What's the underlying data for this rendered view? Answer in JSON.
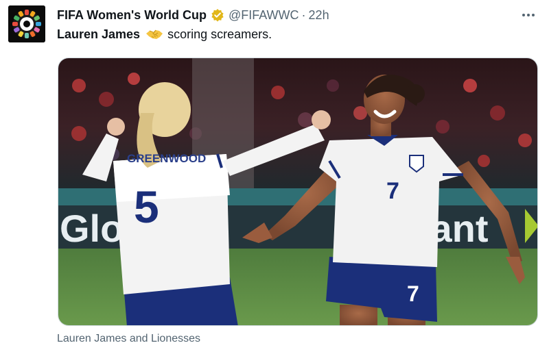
{
  "tweet": {
    "author": {
      "display_name": "FIFA Women's World Cup",
      "handle": "@FIFAWWC",
      "separator": "·",
      "time": "22h",
      "verified_color": "#e2b719",
      "avatar_icon": "fifa-wwc-logo-icon"
    },
    "text": {
      "mention_name": "Lauren James",
      "emoji_icon": "handshake-emoji-icon",
      "body": "scoring screamers."
    },
    "media": {
      "description_icon": "celebration-photo-icon",
      "jersey_left_name": "GREENWOOD",
      "jersey_left_number": "5",
      "jersey_right_number": "7",
      "board_left_text": "Glo",
      "board_right_text": "Globant",
      "shorts_number": "7"
    },
    "caption": "Lauren James and Lionesses",
    "more_icon": "more-options-icon"
  }
}
